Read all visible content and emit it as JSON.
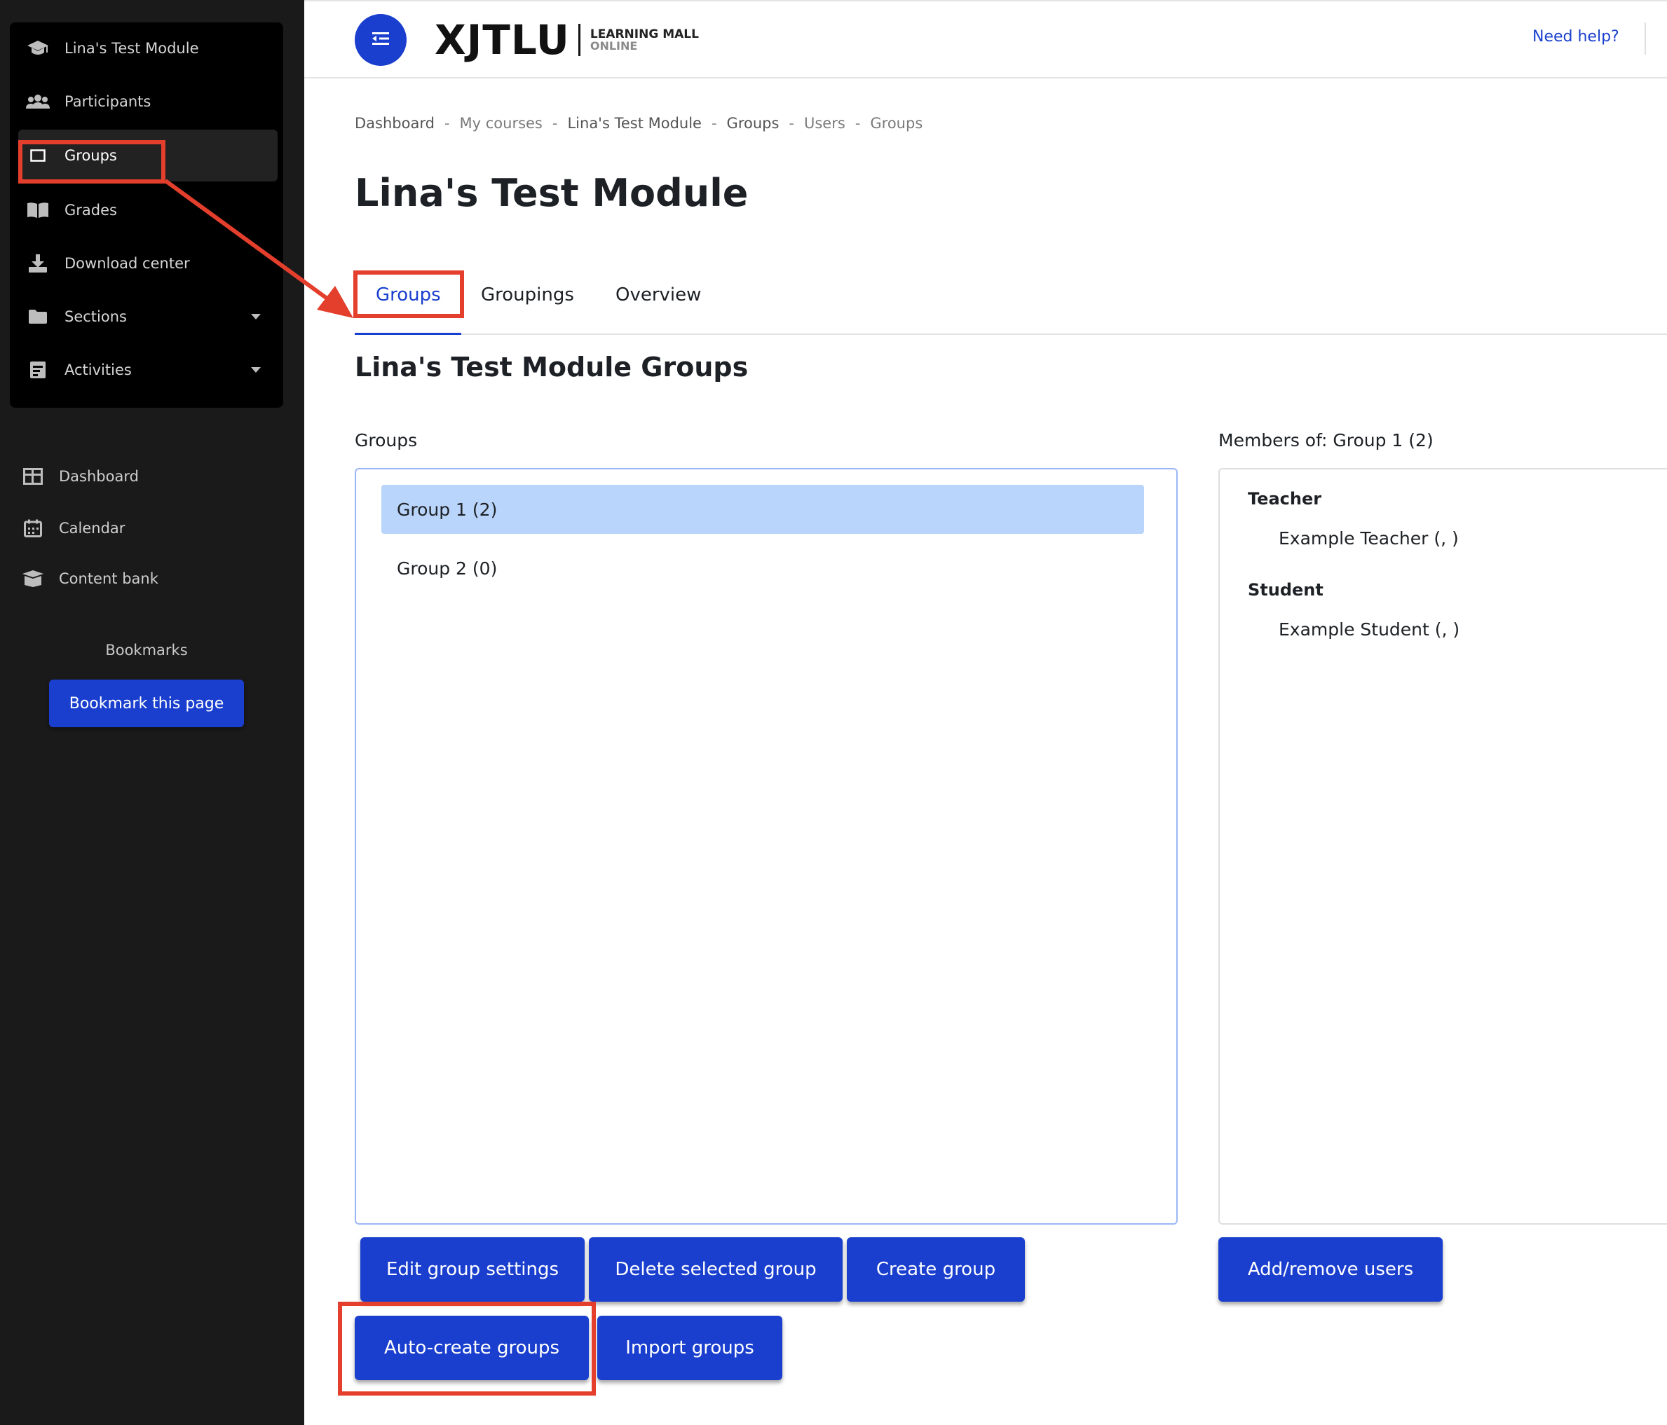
{
  "sidebar": {
    "course_nav": [
      {
        "label": "Lina's Test Module",
        "icon": "graduation-cap-icon"
      },
      {
        "label": "Participants",
        "icon": "users-icon"
      },
      {
        "label": "Groups",
        "icon": "square-icon"
      },
      {
        "label": "Grades",
        "icon": "book-open-icon"
      },
      {
        "label": "Download center",
        "icon": "download-icon"
      },
      {
        "label": "Sections",
        "icon": "folder-icon"
      },
      {
        "label": "Activities",
        "icon": "document-icon"
      }
    ],
    "global_nav": [
      {
        "label": "Dashboard",
        "icon": "dashboard-icon"
      },
      {
        "label": "Calendar",
        "icon": "calendar-icon"
      },
      {
        "label": "Content bank",
        "icon": "box-icon"
      }
    ],
    "bookmarks_title": "Bookmarks",
    "bookmark_button": "Bookmark this page"
  },
  "header": {
    "logo_main": "XJTLU",
    "logo_sub_1": "LEARNING MALL",
    "logo_sub_2": "ONLINE",
    "help_link": "Need help?"
  },
  "breadcrumb": [
    "Dashboard",
    "My courses",
    "Lina's Test Module",
    "Groups",
    "Users",
    "Groups"
  ],
  "breadcrumb_separator": "-",
  "page_title": "Lina's Test Module",
  "tabs": [
    "Groups",
    "Groupings",
    "Overview"
  ],
  "section_title": "Lina's Test Module Groups",
  "groups": {
    "label": "Groups",
    "items": [
      "Group 1 (2)",
      "Group 2 (0)"
    ]
  },
  "members": {
    "label": "Members of: Group 1 (2)",
    "roles": [
      {
        "role": "Teacher",
        "members": [
          "Example Teacher (, )"
        ]
      },
      {
        "role": "Student",
        "members": [
          "Example Student (, )"
        ]
      }
    ]
  },
  "buttons": {
    "edit_group_settings": "Edit group settings",
    "delete_selected_group": "Delete selected group",
    "create_group": "Create group",
    "add_remove_users": "Add/remove users",
    "auto_create_groups": "Auto-create groups",
    "import_groups": "Import groups"
  },
  "colors": {
    "primary": "#1a3fce",
    "sidebar_bg": "#1a1a1a",
    "selected_row": "#bad5fb",
    "annotation": "#e43f2c"
  }
}
